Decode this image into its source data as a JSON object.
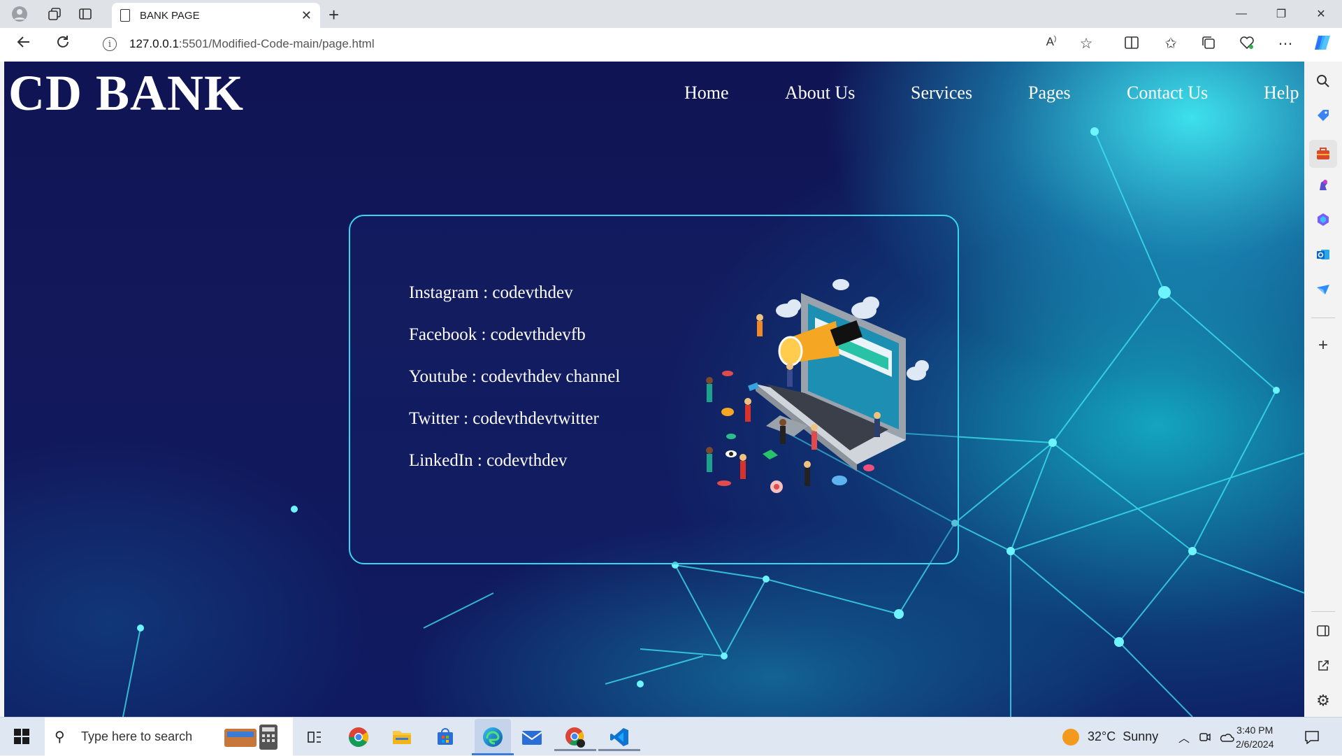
{
  "browser": {
    "tab_title": "BANK PAGE",
    "url_host": "127.0.0.1",
    "url_path": ":5501/Modified-Code-main/page.html"
  },
  "page": {
    "logo": "CD BANK",
    "menu": [
      "Home",
      "About Us",
      "Services",
      "Pages",
      "Contact Us",
      "Help"
    ],
    "contacts": [
      "Instagram : codevthdev",
      "Facebook : codevthdevfb",
      "Youtube : codevthdev channel",
      "Twitter : codevthdevtwitter",
      "LinkedIn : codevthdev"
    ]
  },
  "taskbar": {
    "search_placeholder": "Type here to search",
    "weather": "32°C  Sunny",
    "time": "3:40 PM",
    "date": "2/6/2024"
  },
  "colors": {
    "page_bg": "#12185a",
    "accent": "#38d6ee",
    "text": "#ffffff"
  },
  "icons": [
    "profile-icon",
    "workspaces-icon",
    "tab-actions-icon",
    "back-icon",
    "refresh-icon",
    "info-icon",
    "read-aloud-icon",
    "favorite-star-icon",
    "split-screen-icon",
    "favorites-icon",
    "collections-icon",
    "browser-essentials-icon",
    "more-icon",
    "copilot-icon",
    "search-icon",
    "shopping-icon",
    "tools-icon",
    "games-icon",
    "microsoft365-icon",
    "outlook-icon",
    "drop-icon",
    "add-icon",
    "sidebar-toggle-icon",
    "external-icon",
    "settings-icon"
  ]
}
